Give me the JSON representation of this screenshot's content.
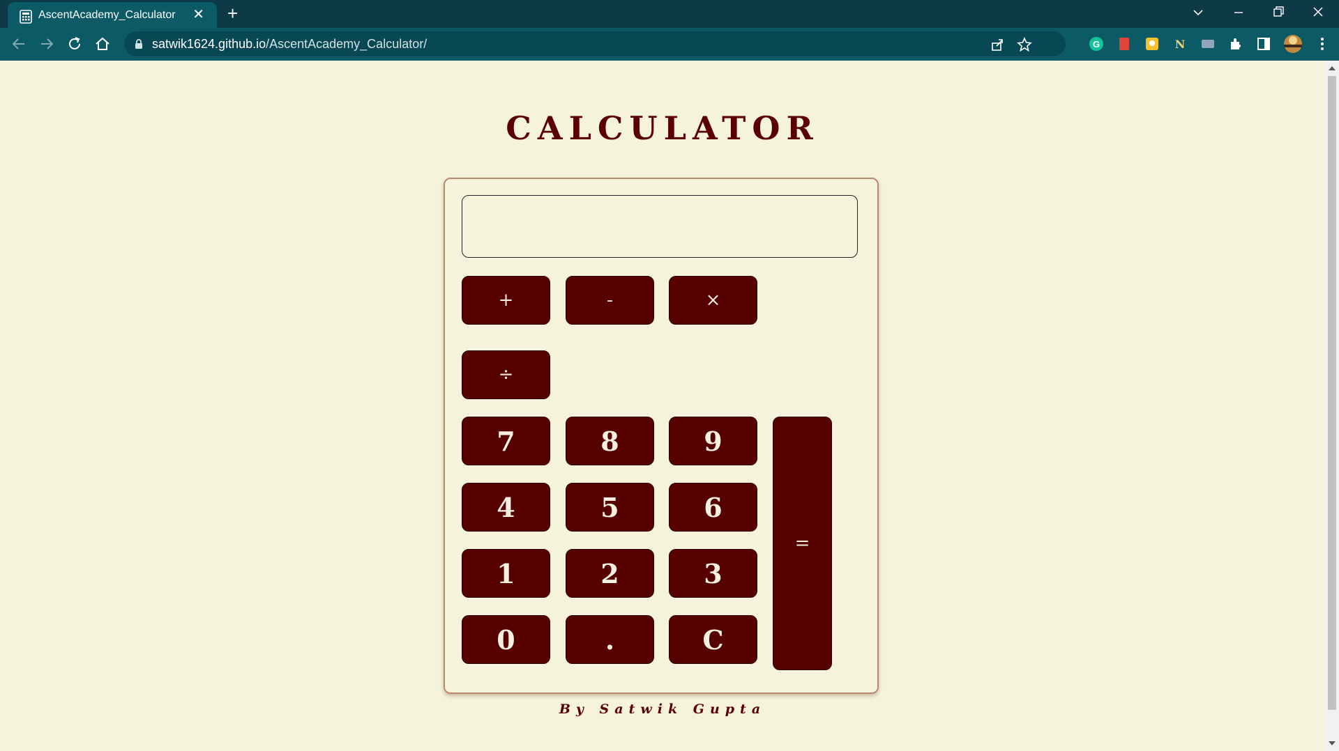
{
  "browser": {
    "tab_title": "AscentAcademy_Calculator",
    "url_host": "satwik1624.github.io",
    "url_path": "/AscentAcademy_Calculator/",
    "new_tab": "+",
    "tab_close": "✕"
  },
  "page": {
    "title": "CALCULATOR",
    "display_value": "",
    "credit": "By Satwik Gupta"
  },
  "buttons": {
    "add": "+",
    "subtract": "-",
    "multiply": "×",
    "divide": "÷",
    "seven": "7",
    "eight": "8",
    "nine": "9",
    "four": "4",
    "five": "5",
    "six": "6",
    "one": "1",
    "two": "2",
    "three": "3",
    "zero": "0",
    "decimal": ".",
    "clear": "C",
    "equals": "="
  },
  "colors": {
    "page_background": "#f5f3dc",
    "accent": "#560000",
    "browser_frame": "#0b5a66"
  }
}
